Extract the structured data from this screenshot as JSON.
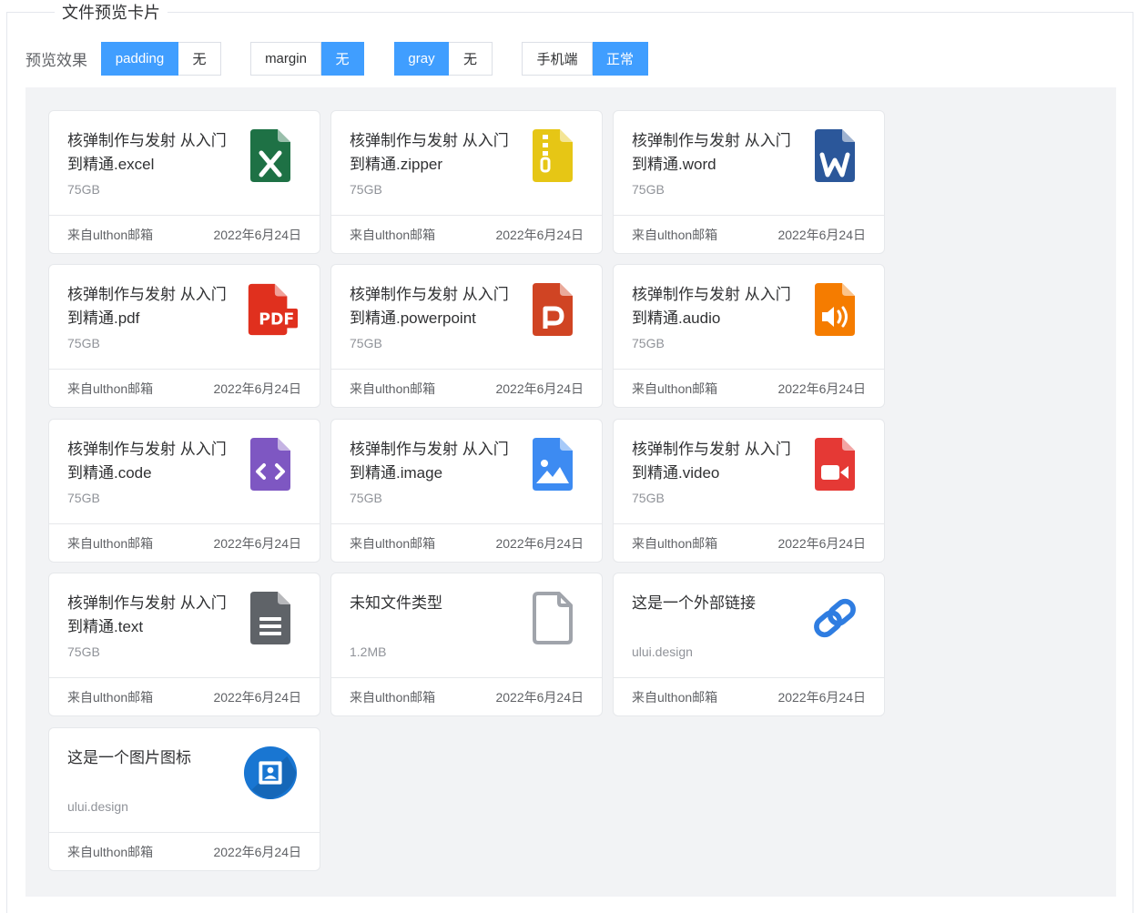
{
  "legend": "文件预览卡片",
  "options": {
    "label": "预览效果",
    "groups": [
      {
        "a": "padding",
        "b": "无"
      },
      {
        "a": "margin",
        "b": "无"
      },
      {
        "a": "gray",
        "b": "无"
      },
      {
        "a": "手机端",
        "b": "正常"
      }
    ]
  },
  "cards": [
    {
      "title": "核弹制作与发射 从入门到精通.excel",
      "size": "75GB",
      "source": "来自ulthon邮箱",
      "date": "2022年6月24日",
      "icon": "excel-file-icon",
      "color": "#1e7145"
    },
    {
      "title": "核弹制作与发射 从入门到精通.zipper",
      "size": "75GB",
      "source": "来自ulthon邮箱",
      "date": "2022年6月24日",
      "icon": "zip-file-icon",
      "color": "#e6c615"
    },
    {
      "title": "核弹制作与发射 从入门到精通.word",
      "size": "75GB",
      "source": "来自ulthon邮箱",
      "date": "2022年6月24日",
      "icon": "word-file-icon",
      "color": "#2b579a"
    },
    {
      "title": "核弹制作与发射 从入门到精通.pdf",
      "size": "75GB",
      "source": "来自ulthon邮箱",
      "date": "2022年6月24日",
      "icon": "pdf-file-icon",
      "color": "#e0301e"
    },
    {
      "title": "核弹制作与发射 从入门到精通.powerpoint",
      "size": "75GB",
      "source": "来自ulthon邮箱",
      "date": "2022年6月24日",
      "icon": "powerpoint-file-icon",
      "color": "#d04423"
    },
    {
      "title": "核弹制作与发射 从入门到精通.audio",
      "size": "75GB",
      "source": "来自ulthon邮箱",
      "date": "2022年6月24日",
      "icon": "audio-file-icon",
      "color": "#f57c00"
    },
    {
      "title": "核弹制作与发射 从入门到精通.code",
      "size": "75GB",
      "source": "来自ulthon邮箱",
      "date": "2022年6月24日",
      "icon": "code-file-icon",
      "color": "#7e57c2"
    },
    {
      "title": "核弹制作与发射 从入门到精通.image",
      "size": "75GB",
      "source": "来自ulthon邮箱",
      "date": "2022年6月24日",
      "icon": "image-file-icon",
      "color": "#3d8bf2"
    },
    {
      "title": "核弹制作与发射 从入门到精通.video",
      "size": "75GB",
      "source": "来自ulthon邮箱",
      "date": "2022年6月24日",
      "icon": "video-file-icon",
      "color": "#e53935"
    },
    {
      "title": "核弹制作与发射 从入门到精通.text",
      "size": "75GB",
      "source": "来自ulthon邮箱",
      "date": "2022年6月24日",
      "icon": "text-file-icon",
      "color": "#5f6368"
    },
    {
      "title": "未知文件类型",
      "size": "1.2MB",
      "source": "来自ulthon邮箱",
      "date": "2022年6月24日",
      "icon": "unknown-file-icon",
      "color": "#a0a4ab"
    },
    {
      "title": "这是一个外部链接",
      "size": "ului.design",
      "source": "来自ulthon邮箱",
      "date": "2022年6月24日",
      "icon": "link-icon",
      "color": "#2f7de1"
    },
    {
      "title": "这是一个图片图标",
      "size": "ului.design",
      "source": "来自ulthon邮箱",
      "date": "2022年6月24日",
      "icon": "portrait-image-icon",
      "color": "#1976d2"
    }
  ],
  "icon_glyphs": {
    "pdf": "PDF"
  }
}
